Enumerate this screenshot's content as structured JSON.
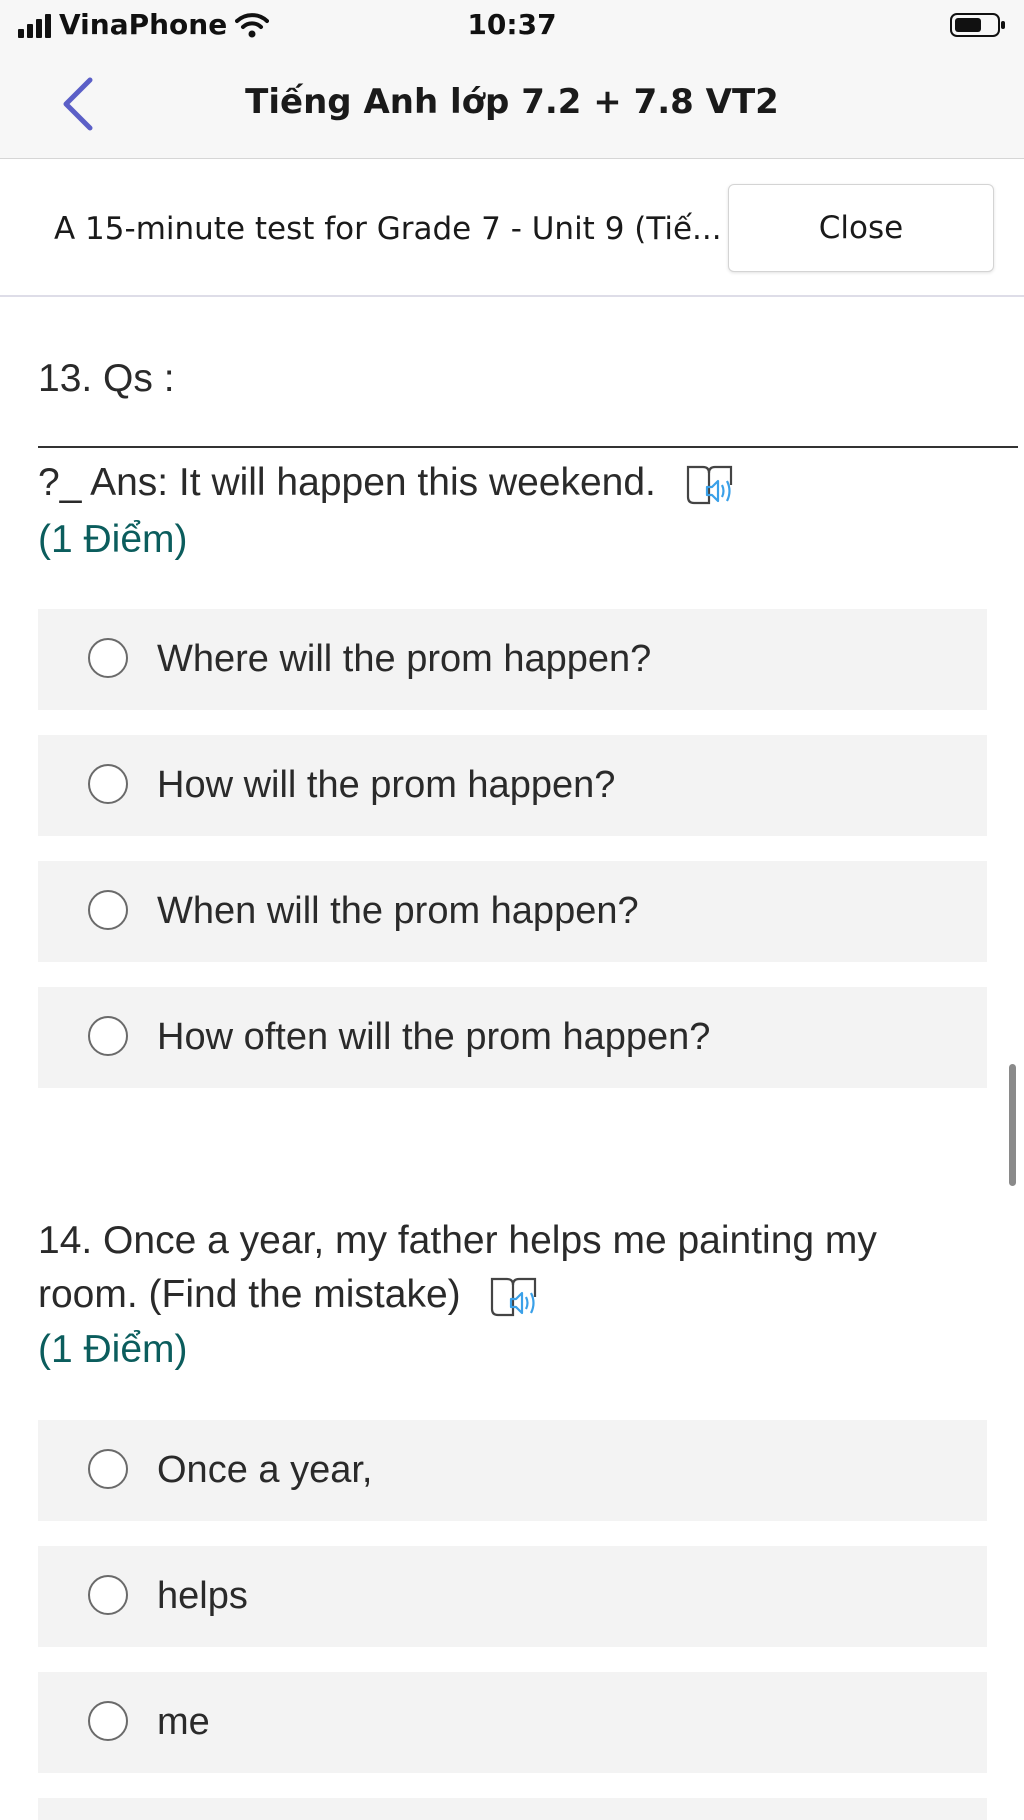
{
  "status": {
    "carrier": "VinaPhone",
    "time": "10:37"
  },
  "nav": {
    "title": "Tiếng Anh lớp 7.2 + 7.8 VT2"
  },
  "form": {
    "title": "A 15-minute test for Grade 7 - Unit 9 (Tiế...",
    "close_label": "Close"
  },
  "questions": [
    {
      "line1": "13. Qs :",
      "line2": "?_ Ans: It will happen this weekend.",
      "points": "(1 Điểm)",
      "options": [
        "Where will the prom happen?",
        "How will the prom happen?",
        "When will the prom happen?",
        "How often will the prom happen?"
      ]
    },
    {
      "line1": "14. Once a year, my father helps me painting my",
      "line2": "room. (Find the mistake)",
      "points": "(1 Điểm)",
      "options": [
        "Once a year,",
        "helps",
        "me"
      ]
    }
  ],
  "icons": {
    "back": "chevron-left-icon",
    "reader": "immersive-reader-icon",
    "wifi": "wifi-icon",
    "battery": "battery-icon"
  },
  "colors": {
    "accent": "#5b5fc7",
    "points": "#0b5d5d",
    "reader_blue": "#3aa0e8"
  }
}
